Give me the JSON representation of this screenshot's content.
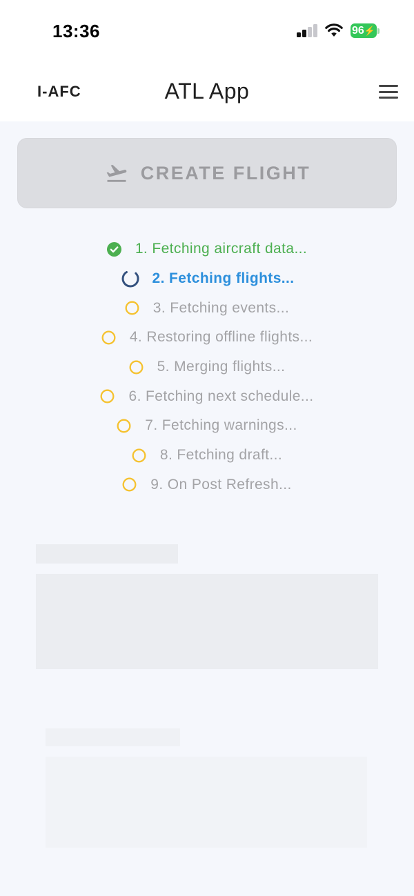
{
  "status_bar": {
    "time": "13:36",
    "battery_level": "96"
  },
  "header": {
    "tail_number": "I-AFC",
    "title": "ATL App",
    "menu_icon": "hamburger-menu-icon"
  },
  "create_flight": {
    "label": "CREATE FLIGHT",
    "icon": "airplane-takeoff-icon"
  },
  "steps": [
    {
      "label": "1. Fetching aircraft data...",
      "state": "done"
    },
    {
      "label": "2. Fetching flights...",
      "state": "active"
    },
    {
      "label": "3. Fetching events...",
      "state": "pending"
    },
    {
      "label": "4. Restoring offline flights...",
      "state": "pending"
    },
    {
      "label": "5. Merging flights...",
      "state": "pending"
    },
    {
      "label": "6. Fetching next schedule...",
      "state": "pending"
    },
    {
      "label": "7. Fetching warnings...",
      "state": "pending"
    },
    {
      "label": "8. Fetching draft...",
      "state": "pending"
    },
    {
      "label": "9. On Post Refresh...",
      "state": "pending"
    }
  ],
  "colors": {
    "done": "#4caf50",
    "active": "#2c8fdc",
    "pending_icon": "#f5c230",
    "spinner": "#34517e"
  }
}
